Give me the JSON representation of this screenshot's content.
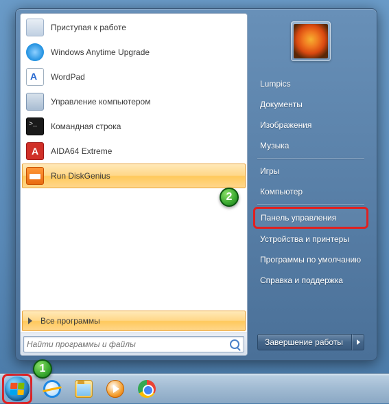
{
  "left_panel": {
    "items": [
      {
        "label": "Приступая к работе"
      },
      {
        "label": "Windows Anytime Upgrade"
      },
      {
        "label": "WordPad"
      },
      {
        "label": "Управление компьютером"
      },
      {
        "label": "Командная строка"
      },
      {
        "label": "AIDA64 Extreme"
      },
      {
        "label": "Run DiskGenius"
      }
    ],
    "all_programs": "Все программы",
    "search_placeholder": "Найти программы и файлы"
  },
  "right_panel": {
    "username": "Lumpics",
    "items_top": [
      "Документы",
      "Изображения",
      "Музыка"
    ],
    "items_mid": [
      "Игры",
      "Компьютер"
    ],
    "control_panel": "Панель управления",
    "items_bot": [
      "Устройства и принтеры",
      "Программы по умолчанию",
      "Справка и поддержка"
    ],
    "shutdown": "Завершение работы"
  },
  "markers": {
    "m1": "1",
    "m2": "2"
  }
}
